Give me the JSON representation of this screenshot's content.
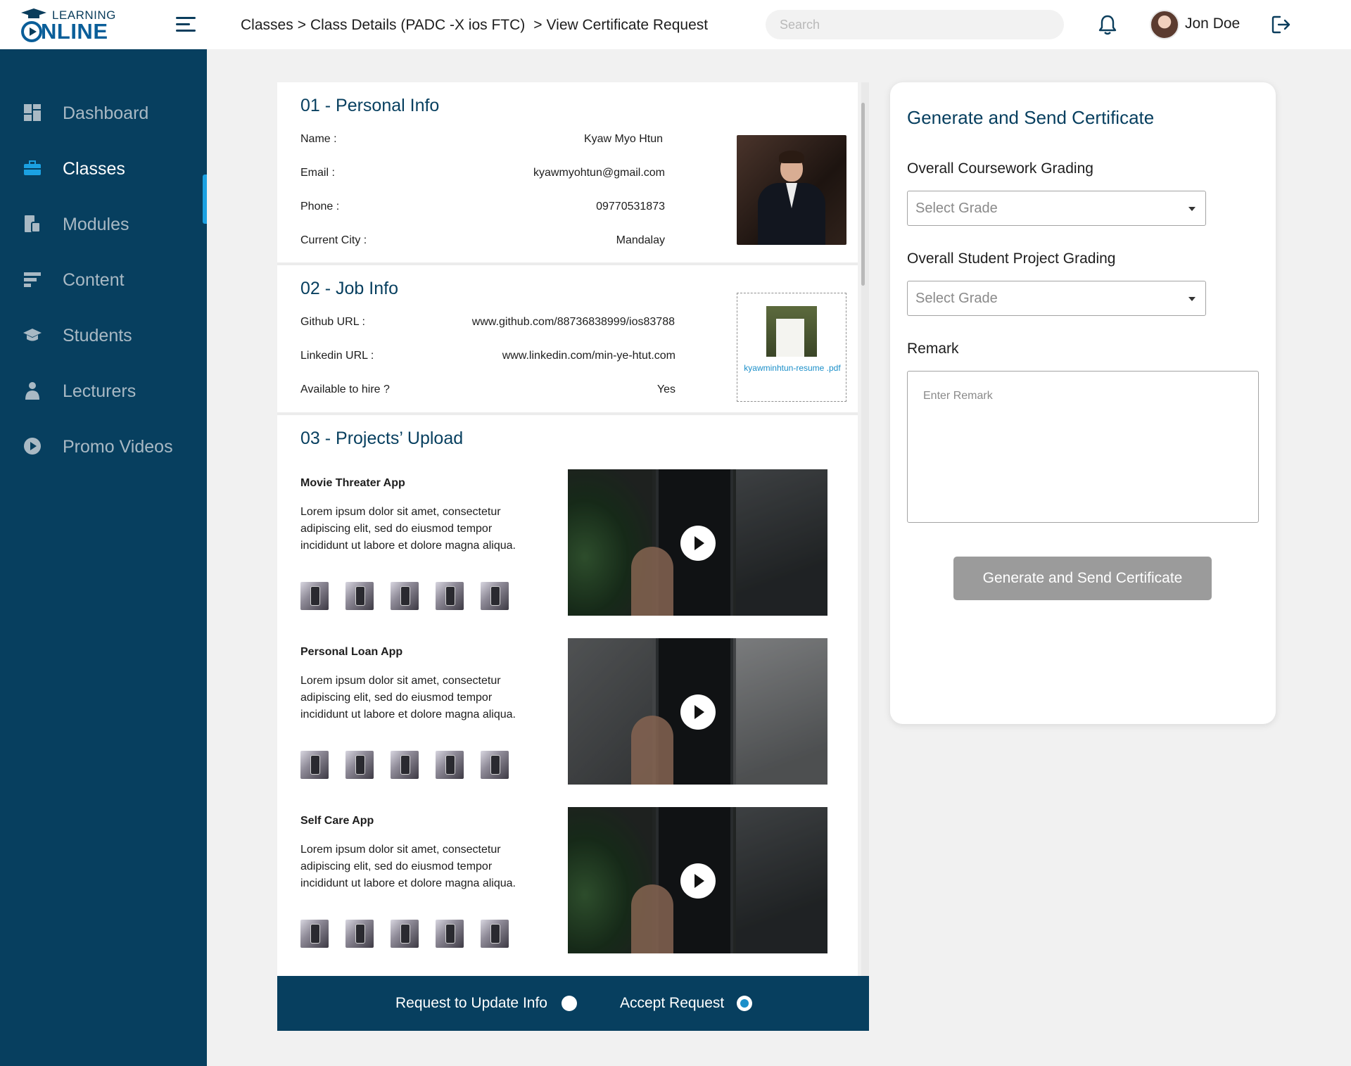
{
  "app": {
    "logo_small": "LEARNING",
    "logo_big": "NLINE"
  },
  "header": {
    "breadcrumb": [
      "Classes",
      "Class Details (PADC -X ios FTC)",
      "View Certificate Request"
    ],
    "search_placeholder": "Search",
    "user_name": "Jon Doe"
  },
  "sidebar": {
    "items": [
      {
        "label": "Dashboard",
        "icon": "dashboard-icon"
      },
      {
        "label": "Classes",
        "icon": "briefcase-icon",
        "active": true
      },
      {
        "label": "Modules",
        "icon": "modules-icon"
      },
      {
        "label": "Content",
        "icon": "content-icon"
      },
      {
        "label": "Students",
        "icon": "graduation-cap-icon"
      },
      {
        "label": "Lecturers",
        "icon": "lecturer-icon"
      },
      {
        "label": "Promo Videos",
        "icon": "play-circle-icon"
      }
    ]
  },
  "personal": {
    "title": "01 - Personal Info",
    "rows": [
      {
        "label": "Name :",
        "value": "Kyaw Myo Htun"
      },
      {
        "label": "Email :",
        "value": "kyawmyohtun@gmail.com"
      },
      {
        "label": "Phone :",
        "value": "09770531873"
      },
      {
        "label": "Current City :",
        "value": "Mandalay"
      }
    ]
  },
  "job": {
    "title": "02 - Job Info",
    "rows": [
      {
        "label": "Github URL :",
        "value": "www.github.com/88736838999/ios83788"
      },
      {
        "label": "Linkedin URL :",
        "value": "www.linkedin.com/min-ye-htut.com"
      },
      {
        "label": "Available to hire ?",
        "value": "Yes"
      }
    ],
    "resume_file": "kyawminhtun-resume .pdf"
  },
  "projects": {
    "title": "03 - Projects’ Upload",
    "items": [
      {
        "name": "Movie Threater App",
        "description": "Lorem ipsum dolor sit amet, consectetur adipiscing elit, sed do eiusmod tempor incididunt ut labore et dolore magna aliqua."
      },
      {
        "name": "Personal Loan App",
        "description": "Lorem ipsum dolor sit amet, consectetur adipiscing elit, sed do eiusmod tempor incididunt ut labore et dolore magna aliqua."
      },
      {
        "name": "Self Care App",
        "description": "Lorem ipsum dolor sit amet, consectetur adipiscing elit, sed do eiusmod tempor incididunt ut labore et dolore magna aliqua."
      }
    ]
  },
  "actions": {
    "request_update": "Request to Update Info",
    "accept": "Accept Request",
    "selected": "accept"
  },
  "certificate": {
    "title": "Generate and Send Certificate",
    "coursework_label": "Overall Coursework Grading",
    "coursework_value": "Select Grade",
    "project_label": "Overall Student Project Grading",
    "project_value": "Select Grade",
    "remark_label": "Remark",
    "remark_placeholder": "Enter Remark",
    "button_label": "Generate and Send Certificate"
  },
  "colors": {
    "primary": "#073f5f",
    "accent": "#1ba1e2",
    "button_disabled": "#9b9b9b"
  }
}
